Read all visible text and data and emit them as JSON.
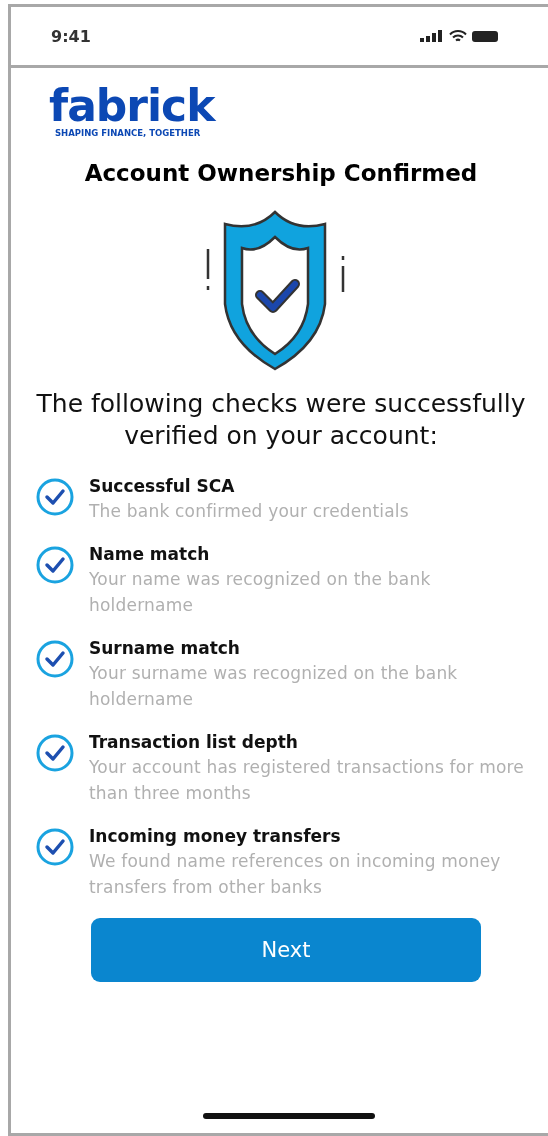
{
  "status_bar": {
    "time": "9:41"
  },
  "logo": {
    "name": "fabrick",
    "tagline": "SHAPING FINANCE, TOGETHER"
  },
  "title": "Account Ownership Confirmed",
  "intro": "The following checks were successfully verified on your account:",
  "checks": [
    {
      "title": "Successful SCA",
      "description": "The bank confirmed your credentials",
      "checked": true
    },
    {
      "title": "Name match",
      "description": "Your name was recognized on the bank holdername",
      "checked": true
    },
    {
      "title": "Surname match",
      "description": "Your surname was recognized on the bank holdername",
      "checked": true
    },
    {
      "title": "Transaction list depth",
      "description": "Your account has registered transactions for more than three months",
      "checked": true
    },
    {
      "title": "Incoming money transfers",
      "description": "We found name references on incoming money transfers from other banks",
      "checked": true
    }
  ],
  "button": {
    "label": "Next"
  }
}
